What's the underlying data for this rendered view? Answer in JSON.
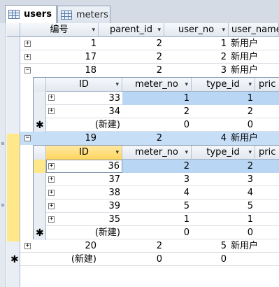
{
  "tabs": [
    {
      "label": "users",
      "active": true
    },
    {
      "label": "meters",
      "active": false
    }
  ],
  "main": {
    "columns": [
      "编号",
      "parent_id",
      "user_no",
      "user_name"
    ],
    "rows": [
      {
        "id": "1",
        "parent_id": "2",
        "user_no": "1",
        "user_name": "新用户",
        "expand": "+"
      },
      {
        "id": "17",
        "parent_id": "2",
        "user_no": "2",
        "user_name": "新用户",
        "expand": "+"
      },
      {
        "id": "18",
        "parent_id": "2",
        "user_no": "3",
        "user_name": "新用户",
        "expand": "−"
      },
      {
        "id": "19",
        "parent_id": "2",
        "user_no": "4",
        "user_name": "新用户",
        "expand": "−"
      },
      {
        "id": "20",
        "parent_id": "2",
        "user_no": "5",
        "user_name": "新用户",
        "expand": "+"
      }
    ],
    "new_row": {
      "id": "(新建)",
      "parent_id": "0",
      "user_no": "0"
    }
  },
  "sub1": {
    "columns": [
      "ID",
      "meter_no",
      "type_id",
      "pric"
    ],
    "rows": [
      {
        "id": "33",
        "meter_no": "1",
        "type_id": "1"
      },
      {
        "id": "34",
        "meter_no": "2",
        "type_id": "2"
      }
    ],
    "new_row": {
      "id": "(新建)",
      "meter_no": "0",
      "type_id": "0"
    }
  },
  "sub2": {
    "columns": [
      "ID",
      "meter_no",
      "type_id",
      "pric"
    ],
    "rows": [
      {
        "id": "36",
        "meter_no": "2",
        "type_id": "2"
      },
      {
        "id": "37",
        "meter_no": "3",
        "type_id": "3"
      },
      {
        "id": "38",
        "meter_no": "4",
        "type_id": "4"
      },
      {
        "id": "39",
        "meter_no": "5",
        "type_id": "5"
      },
      {
        "id": "35",
        "meter_no": "1",
        "type_id": "1"
      }
    ],
    "new_row": {
      "id": "(新建)",
      "meter_no": "0",
      "type_id": "0"
    }
  },
  "glyphs": {
    "dropdown": "▾",
    "new_record": "✱"
  }
}
